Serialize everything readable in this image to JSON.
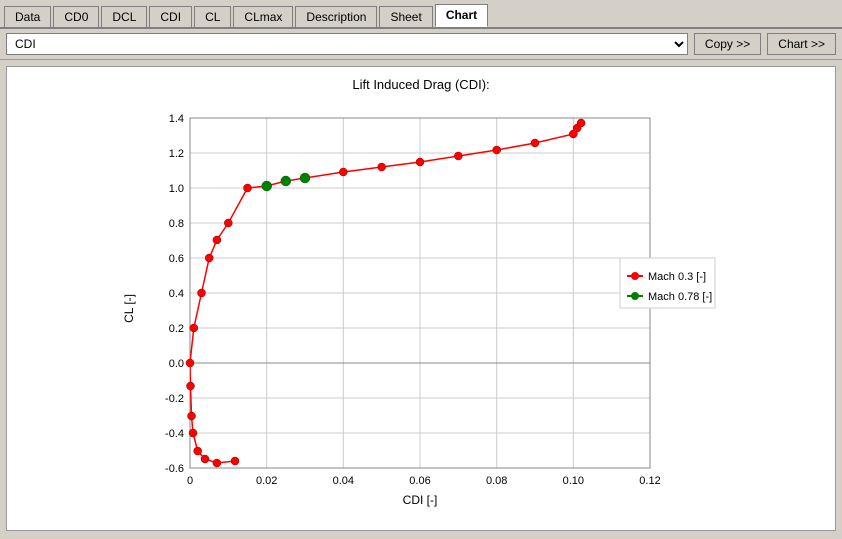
{
  "tabs": [
    {
      "label": "Data",
      "active": false
    },
    {
      "label": "CD0",
      "active": false
    },
    {
      "label": "DCL",
      "active": false
    },
    {
      "label": "CDI",
      "active": false
    },
    {
      "label": "CL",
      "active": false
    },
    {
      "label": "CLmax",
      "active": false
    },
    {
      "label": "Description",
      "active": false
    },
    {
      "label": "Sheet",
      "active": false
    },
    {
      "label": "Chart",
      "active": true
    }
  ],
  "toolbar": {
    "select_value": "CDI",
    "copy_button": "Copy >>",
    "chart_button": "Chart >>"
  },
  "chart": {
    "title": "Lift Induced Drag (CDI):",
    "x_label": "CDI [-]",
    "y_label": "CL [-]",
    "x_min": 0,
    "x_max": 0.12,
    "y_min": -0.6,
    "y_max": 1.4,
    "x_ticks": [
      0,
      0.02,
      0.04,
      0.06,
      0.08,
      0.1,
      0.12
    ],
    "y_ticks": [
      -0.6,
      -0.4,
      -0.2,
      0.0,
      0.2,
      0.4,
      0.6,
      0.8,
      1.0,
      1.2,
      1.4
    ]
  },
  "legend": {
    "items": [
      {
        "label": "Mach 0.3 [-]",
        "color": "red"
      },
      {
        "label": "Mach 0.78 [-]",
        "color": "green"
      }
    ]
  }
}
